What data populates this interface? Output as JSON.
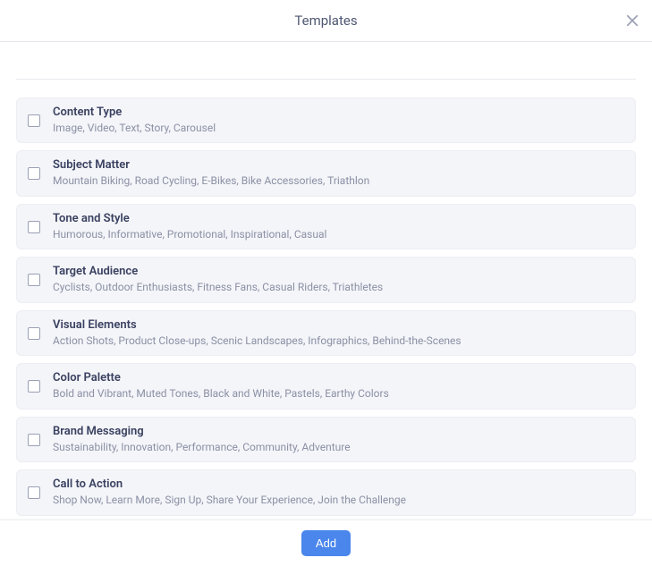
{
  "header": {
    "title": "Templates"
  },
  "footer": {
    "add_label": "Add"
  },
  "templates": [
    {
      "title": "Content Type",
      "desc": "Image, Video, Text, Story, Carousel"
    },
    {
      "title": "Subject Matter",
      "desc": "Mountain Biking, Road Cycling, E-Bikes, Bike Accessories, Triathlon"
    },
    {
      "title": "Tone and Style",
      "desc": "Humorous, Informative, Promotional, Inspirational, Casual"
    },
    {
      "title": "Target Audience",
      "desc": "Cyclists, Outdoor Enthusiasts, Fitness Fans, Casual Riders, Triathletes"
    },
    {
      "title": "Visual Elements",
      "desc": "Action Shots, Product Close-ups, Scenic Landscapes, Infographics, Behind-the-Scenes"
    },
    {
      "title": "Color Palette",
      "desc": "Bold and Vibrant, Muted Tones, Black and White, Pastels, Earthy Colors"
    },
    {
      "title": "Brand Messaging",
      "desc": "Sustainability, Innovation, Performance, Community, Adventure"
    },
    {
      "title": "Call to Action",
      "desc": "Shop Now, Learn More, Sign Up, Share Your Experience, Join the Challenge"
    }
  ]
}
